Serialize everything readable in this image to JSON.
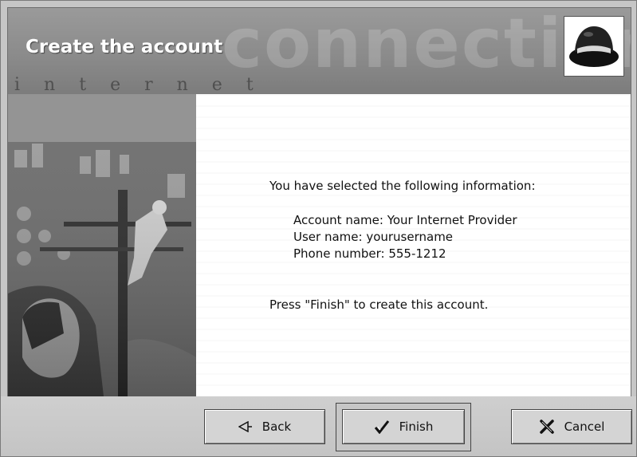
{
  "window": {
    "title": "Create the account",
    "banner_watermark": "connection",
    "banner_letters": [
      "i",
      "n",
      "t",
      "e",
      "r",
      "n",
      "e",
      "t"
    ]
  },
  "logo": {
    "icon": "redhat-shadowman-icon"
  },
  "content": {
    "intro": "You have selected the following information:",
    "details": {
      "account": "Account name: Your Internet Provider",
      "user": "User name: yourusername",
      "phone": "Phone number: 555-1212"
    },
    "instruction": "Press \"Finish\" to create this account."
  },
  "buttons": {
    "back": {
      "label": "Back",
      "icon": "back-arrow-icon"
    },
    "finish": {
      "label": "Finish",
      "icon": "checkmark-icon"
    },
    "cancel": {
      "label": "Cancel",
      "icon": "cancel-x-icon"
    }
  }
}
